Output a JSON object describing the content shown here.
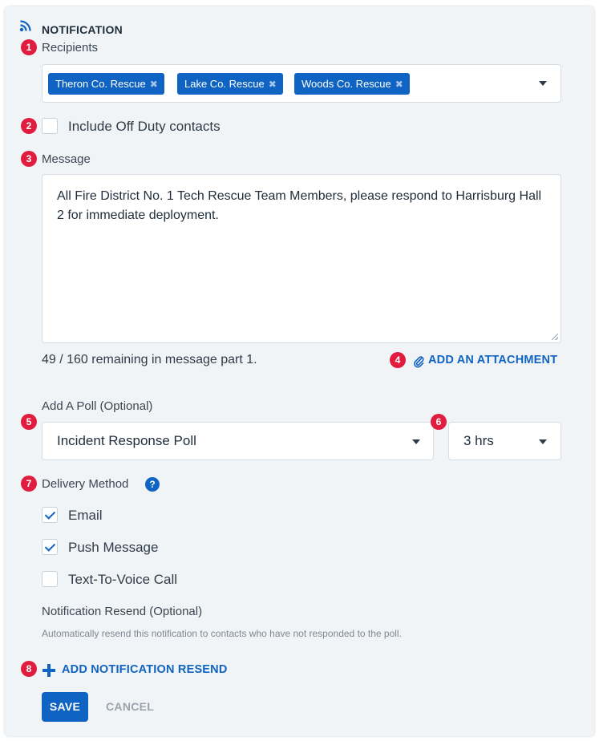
{
  "header": {
    "title": "NOTIFICATION",
    "icon": "rss-feed-icon"
  },
  "markers": [
    "1",
    "2",
    "3",
    "4",
    "5",
    "6",
    "7",
    "8"
  ],
  "recipients": {
    "label": "Recipients",
    "chips": [
      {
        "label": "Theron Co. Rescue",
        "remove": "✖"
      },
      {
        "label": "Lake Co. Rescue",
        "remove": "✖"
      },
      {
        "label": "Woods Co. Rescue",
        "remove": "✖"
      }
    ]
  },
  "off_duty": {
    "label": "Include Off Duty contacts",
    "checked": false
  },
  "message": {
    "label": "Message",
    "value": "All Fire District No. 1 Tech Rescue Team Members, please respond to Harrisburg Hall 2 for immediate deployment.",
    "remaining": "49 / 160 remaining in message part 1.",
    "attachment_label": "ADD AN ATTACHMENT"
  },
  "poll": {
    "label": "Add A Poll (Optional)",
    "selected": "Incident Response Poll",
    "duration": "3 hrs"
  },
  "delivery": {
    "label": "Delivery Method",
    "help": "?",
    "options": [
      {
        "label": "Email",
        "checked": true
      },
      {
        "label": "Push Message",
        "checked": true
      },
      {
        "label": "Text-To-Voice Call",
        "checked": false
      }
    ]
  },
  "resend": {
    "label": "Notification Resend (Optional)",
    "description": "Automatically resend this notification to contacts who have not responded to the poll.",
    "add_label": "ADD NOTIFICATION RESEND"
  },
  "actions": {
    "save": "SAVE",
    "cancel": "CANCEL"
  },
  "colors": {
    "accent": "#0f63c2",
    "marker": "#e11d3f",
    "card_bg": "#f1f4f7"
  }
}
